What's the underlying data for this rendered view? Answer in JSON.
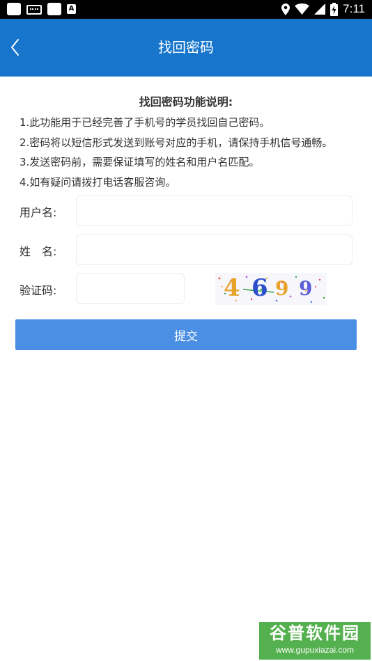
{
  "status_bar": {
    "time": "7:11",
    "icons": [
      "app-notification-icon",
      "keyboard-icon",
      "app-notification-icon",
      "a-text-icon",
      "location-icon",
      "wifi-icon",
      "signal-icon",
      "battery-charging-icon"
    ]
  },
  "header": {
    "title": "找回密码",
    "back_icon": "chevron-left-icon"
  },
  "instructions": {
    "heading": "找回密码功能说明:",
    "lines": [
      "1.此功能用于已经完善了手机号的学员找回自己密码。",
      "2.密码将以短信形式发送到账号对应的手机，请保持手机信号通畅。",
      "3.发送密码前，需要保证填写的姓名和用户名匹配。",
      "4.如有疑问请拨打电话客服咨询。"
    ]
  },
  "form": {
    "username_label": "用户名:",
    "username_value": "",
    "name_label": "姓　名:",
    "name_value": "",
    "captcha_label": "验证码:",
    "captcha_value": "",
    "captcha_text": [
      "4",
      "6",
      "9",
      "9"
    ],
    "submit_label": "提交"
  },
  "watermark": {
    "title": "谷普软件园",
    "url": "www.gupuxiazai.com"
  },
  "colors": {
    "header_bg": "#1776cc",
    "submit_bg": "#4a8fe4",
    "watermark_bg": "#55b04f"
  }
}
